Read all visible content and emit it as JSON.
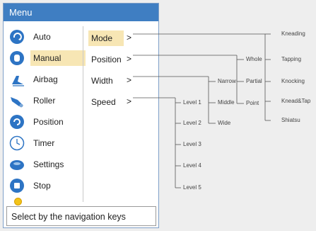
{
  "menu": {
    "title": "Menu",
    "items": [
      {
        "label": "Auto",
        "icon": "auto-icon"
      },
      {
        "label": "Manual",
        "icon": "hand-icon"
      },
      {
        "label": "Airbag",
        "icon": "airbag-icon"
      },
      {
        "label": "Roller",
        "icon": "roller-icon"
      },
      {
        "label": "Position",
        "icon": "position-icon"
      },
      {
        "label": "Timer",
        "icon": "clock-icon"
      },
      {
        "label": "Settings",
        "icon": "settings-icon"
      },
      {
        "label": "Stop",
        "icon": "stop-icon"
      }
    ],
    "active_item": "Manual"
  },
  "submenu": {
    "items": [
      {
        "label": "Mode",
        "arrow": ">"
      },
      {
        "label": "Position",
        "arrow": ">"
      },
      {
        "label": "Width",
        "arrow": ">"
      },
      {
        "label": "Speed",
        "arrow": ">"
      }
    ],
    "active_item": "Mode"
  },
  "hint": {
    "text": "Select by the navigation keys"
  },
  "tree": {
    "modes": [
      "Kneading",
      "Tapping",
      "Knocking",
      "Knead&Tap",
      "Shiatsu"
    ],
    "positions": [
      "Whole",
      "Partial",
      "Point"
    ],
    "widths": [
      "Narrow",
      "Middle",
      "Wide"
    ],
    "speeds": [
      "Level 1",
      "Level 2",
      "Level 3",
      "Level 4",
      "Level 5"
    ]
  },
  "colors": {
    "header_bg": "#3f7ec2",
    "active_bg": "#f7e6b4",
    "icon_blue": "#2d74c4"
  }
}
